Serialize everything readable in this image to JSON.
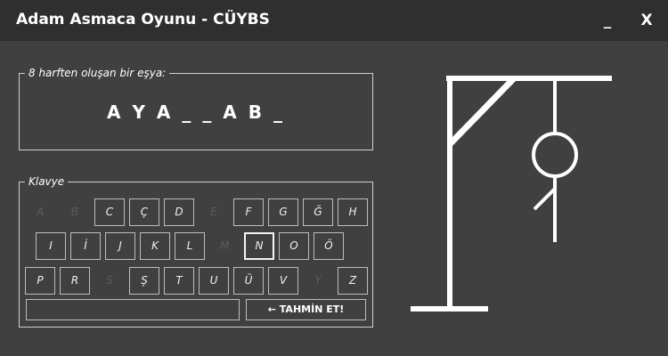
{
  "window": {
    "title": "Adam Asmaca Oyunu - CÜYBS",
    "minimize_label": "_",
    "close_label": "X"
  },
  "word_panel": {
    "legend": "8 harften oluşan bir eşya:",
    "masked_word": "A Y A _ _ A B _"
  },
  "keyboard": {
    "legend": "Klavye",
    "rows": [
      [
        {
          "label": "A",
          "state": "disabled"
        },
        {
          "label": "B",
          "state": "disabled"
        },
        {
          "label": "C",
          "state": "enabled"
        },
        {
          "label": "Ç",
          "state": "enabled"
        },
        {
          "label": "D",
          "state": "enabled"
        },
        {
          "label": "E",
          "state": "disabled"
        },
        {
          "label": "F",
          "state": "enabled"
        },
        {
          "label": "G",
          "state": "enabled"
        },
        {
          "label": "Ğ",
          "state": "enabled"
        },
        {
          "label": "H",
          "state": "enabled"
        }
      ],
      [
        {
          "label": "I",
          "state": "enabled"
        },
        {
          "label": "İ",
          "state": "enabled"
        },
        {
          "label": "J",
          "state": "enabled"
        },
        {
          "label": "K",
          "state": "enabled"
        },
        {
          "label": "L",
          "state": "enabled"
        },
        {
          "label": "M",
          "state": "disabled"
        },
        {
          "label": "N",
          "state": "selected"
        },
        {
          "label": "O",
          "state": "enabled"
        },
        {
          "label": "Ö",
          "state": "enabled"
        }
      ],
      [
        {
          "label": "P",
          "state": "enabled"
        },
        {
          "label": "R",
          "state": "enabled"
        },
        {
          "label": "S",
          "state": "disabled"
        },
        {
          "label": "Ş",
          "state": "enabled"
        },
        {
          "label": "T",
          "state": "enabled"
        },
        {
          "label": "U",
          "state": "enabled"
        },
        {
          "label": "Ü",
          "state": "enabled"
        },
        {
          "label": "V",
          "state": "enabled"
        },
        {
          "label": "Y",
          "state": "disabled"
        },
        {
          "label": "Z",
          "state": "enabled"
        }
      ]
    ],
    "guess_input": {
      "value": "",
      "placeholder": ""
    },
    "guess_button_label": "← TAHMİN ET!"
  },
  "hangman": {
    "parts_drawn": [
      "base",
      "pole",
      "beam",
      "brace",
      "rope",
      "head",
      "body",
      "left-arm"
    ]
  },
  "colors": {
    "background": "#404040",
    "titlebar": "#2f2f2f",
    "text": "#ffffff",
    "disabled_key_text": "#5c5c5c",
    "border": "#bdbdbd"
  }
}
